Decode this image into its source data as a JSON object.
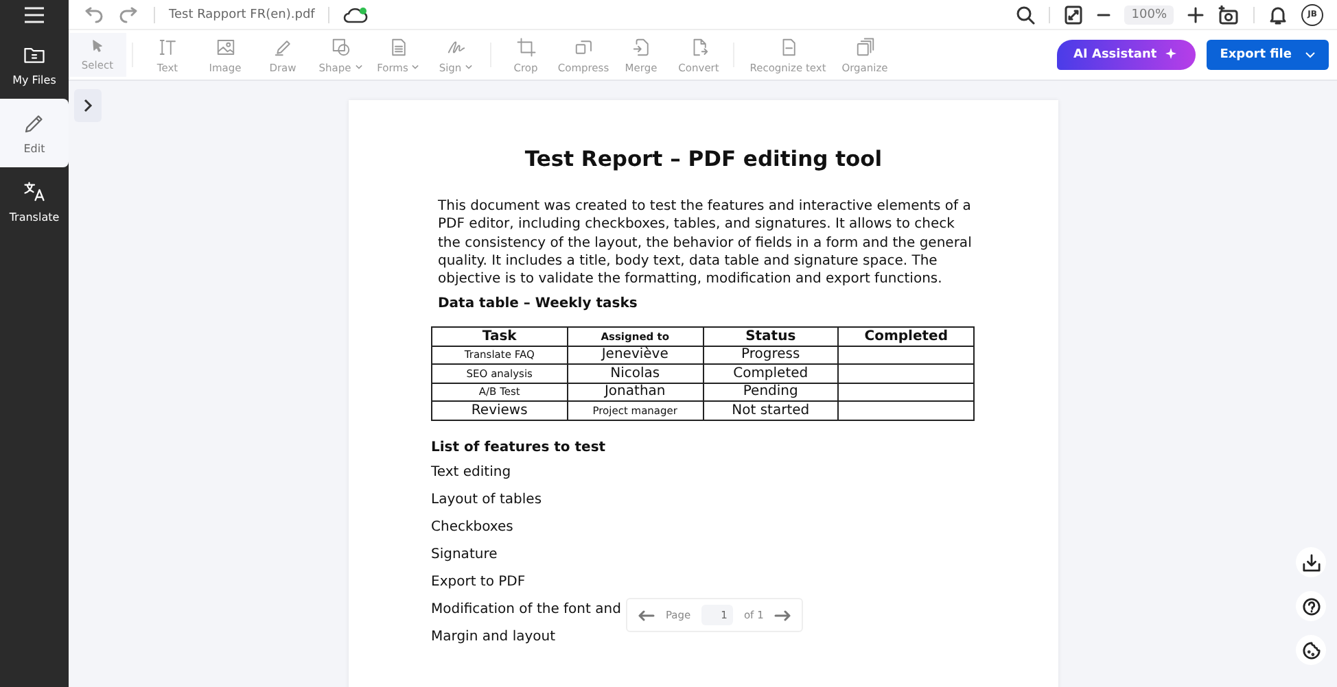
{
  "sidebar": {
    "items": [
      {
        "label": "My Files",
        "selected": false
      },
      {
        "label": "Edit",
        "selected": true
      },
      {
        "label": "Translate",
        "selected": false
      }
    ]
  },
  "topbar": {
    "file_name": "Test Rapport FR(en).pdf",
    "zoom": "100%",
    "avatar": "JB"
  },
  "toolbar": {
    "tools": [
      {
        "label": "Select",
        "dropdown": false,
        "selected": true
      },
      {
        "label": "Text",
        "dropdown": false,
        "selected": false
      },
      {
        "label": "Image",
        "dropdown": false,
        "selected": false
      },
      {
        "label": "Draw",
        "dropdown": false,
        "selected": false
      },
      {
        "label": "Shape",
        "dropdown": true,
        "selected": false
      },
      {
        "label": "Forms",
        "dropdown": true,
        "selected": false
      },
      {
        "label": "Sign",
        "dropdown": true,
        "selected": false
      },
      {
        "label": "Crop",
        "dropdown": false,
        "selected": false
      },
      {
        "label": "Compress",
        "dropdown": false,
        "selected": false
      },
      {
        "label": "Merge",
        "dropdown": false,
        "selected": false
      },
      {
        "label": "Convert",
        "dropdown": false,
        "selected": false
      },
      {
        "label": "Recognize text",
        "dropdown": false,
        "selected": false
      },
      {
        "label": "Organize",
        "dropdown": false,
        "selected": false
      }
    ],
    "ai_button": "AI Assistant",
    "export_button": "Export file"
  },
  "document": {
    "title": "Test Report – PDF editing tool",
    "intro": "This document was created to test the features and interactive elements of a PDF editor, including checkboxes, tables, and signatures. It allows to check the consistency of the layout, the behavior of fields in a form and the general quality. It includes a title, body text, data table and signature space. The objective is to validate the formatting, modification and export functions.",
    "table_heading": "Data table – Weekly tasks",
    "table": {
      "columns": [
        "Task",
        "Assigned to",
        "Status",
        "Completed"
      ],
      "rows": [
        [
          "Translate FAQ",
          "Jeneviève",
          "Progress",
          ""
        ],
        [
          "SEO analysis",
          "Nicolas",
          "Completed",
          ""
        ],
        [
          "A/B Test",
          "Jonathan",
          "Pending",
          ""
        ],
        [
          "Reviews",
          "Project manager",
          "Not started",
          ""
        ]
      ]
    },
    "list_heading": "List of features to test",
    "list": [
      "Text editing",
      "Layout of tables",
      "Checkboxes",
      "Signature",
      "Export to PDF",
      "Modification of the font and",
      "Margin and layout"
    ]
  },
  "pager": {
    "label": "Page",
    "value": "1",
    "total": "of 1"
  }
}
